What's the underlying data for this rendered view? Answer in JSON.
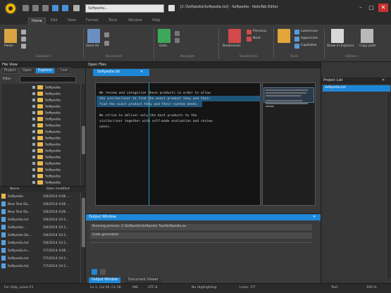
{
  "titlebar": {
    "combo_value": "Softpedia...",
    "title": "[C:\\Softpedia\\Softpedia.txt] - Softpedia - NoteTab Editor",
    "minimize": "–",
    "maximize": "□",
    "close": "✕"
  },
  "menu_tabs": [
    "Home",
    "Edit",
    "View",
    "Format",
    "Tools",
    "Window",
    "Help"
  ],
  "ribbon": {
    "groups": [
      "Clipboard",
      "Document",
      "Navigate",
      "Bookmarks",
      "Tools",
      "Options"
    ],
    "labels": {
      "paste": "Paste",
      "save_as": "Save As",
      "goto": "Goto",
      "bookmarks": "Bookmarks",
      "previous": "Previous",
      "next": "Next",
      "lowercase": "Lowercase",
      "uppercase": "Uppercase",
      "capitalize": "Capitalize",
      "show_in_explorer": "Show in Explorer",
      "copy_path": "Copy path"
    }
  },
  "sidebar": {
    "title": "File View",
    "tabs": [
      "Project",
      "Open",
      "Explorer",
      "Live"
    ],
    "filter_label": "Filter",
    "tree": [
      "Softpedia",
      "Softpedia",
      "Softpedia",
      "Softpedia",
      "Softpedia",
      "Softpedia",
      "Softpedia",
      "Softpedia",
      "Softpedia",
      "Softpedia",
      "Softpedia",
      "Softpedia",
      "Softpedia",
      "Softpedia",
      "Softpedia",
      "Softpedia"
    ],
    "files_header": {
      "name": "Name",
      "date": "Date modified"
    },
    "files": [
      {
        "name": "Softpedia",
        "date": "5/6/2014 4:06 ..."
      },
      {
        "name": "New Text Do...",
        "date": "5/6/2014 4:06 ..."
      },
      {
        "name": "New Text Do...",
        "date": "5/6/2014 4:06 ..."
      },
      {
        "name": "Softpedia.txt",
        "date": "5/6/2014 10:1..."
      },
      {
        "name": "Softpedia...",
        "date": "5/6/2014 10:1..."
      },
      {
        "name": "Softpedia Do...",
        "date": "5/6/2014 10:1..."
      },
      {
        "name": "Softpedia.txt",
        "date": "5/6/2014 10:1..."
      },
      {
        "name": "Softpedia.tx...",
        "date": "7/7/2014 4:06 ..."
      },
      {
        "name": "Softpedia.txt",
        "date": "7/7/2014 10:1..."
      },
      {
        "name": "Softpedia.txt",
        "date": "7/7/2014 10:1..."
      }
    ]
  },
  "editor": {
    "panel_title": "Open Files",
    "tab_label": "Softpedia.txt",
    "lines": [
      "We review and categorize these products in order to allow",
      "the visitor/user to find the exact product they and their",
      "find the exact product they and their system needs.",
      "",
      "We strive to deliver only the best products to the",
      "visitor/user together with self-made evaluation and review",
      "notes."
    ]
  },
  "rightpanel": {
    "title": "Project List",
    "item": "Softpedia.txt"
  },
  "output": {
    "title": "Output Window",
    "lines": [
      "Running process: C:\\Softpedia\\Softpedia Tool\\Softpedia.ex",
      "Code generated"
    ],
    "tabs": [
      "Output Window",
      "Document Viewer"
    ]
  },
  "statusbar": {
    "left": "For Help, press F1",
    "pos": "Ln 1, Col 56, Ch 56",
    "insert": "INS",
    "encoding": "UTF-8",
    "highlighting": "No Highlighting",
    "lines": "Lines: 7/7",
    "right": "Text",
    "zoom": "100 %"
  },
  "colors": {
    "accent": "#1e88d8",
    "background": "#3a3a3a",
    "editor": "#141414"
  }
}
